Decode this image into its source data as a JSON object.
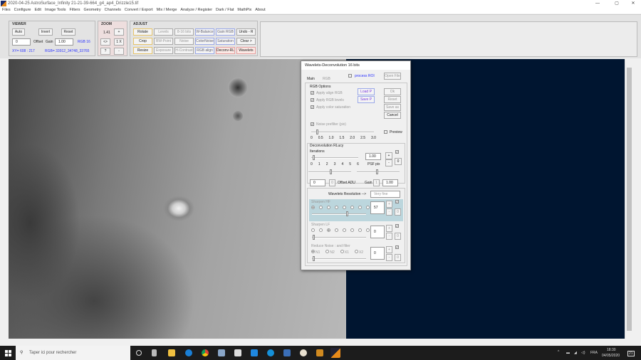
{
  "window": {
    "title": "2020-04-25  AstroSurface_Infinity   21-21-39-664_g4_ap4_Drizzle15.tif",
    "min": "—",
    "max": "▢",
    "close": "✕"
  },
  "menu": [
    "Files",
    "Configure",
    "Edit",
    "Image Tools",
    "Filters",
    "Geometry",
    "Channels",
    "Convert / Export",
    "Mix / Merge",
    "Analyze / Register",
    "Dark / Flat",
    "MathPix",
    "About"
  ],
  "viewer": {
    "label": "VIEWER",
    "auto": "Auto",
    "invert": "Invert",
    "reset": "Reset",
    "offset_value": "0",
    "offset_label": "Offset",
    "gain_label": "Gain",
    "gain_value": "1.00",
    "rgb_mode": "RGB 16",
    "xy": "XY= 608 : 217",
    "rgb": "RGB= 33912_34748_33765"
  },
  "zoom": {
    "label": "ZOOM",
    "level": "1.41",
    "plus": "+",
    "fit": "<>",
    "one": "1 X",
    "help": "?",
    "minus": "-"
  },
  "adjust": {
    "label": "ADJUST",
    "buttons": [
      "Rotate",
      "Levels",
      "8-16 bits",
      "W-Balance",
      "Gain RGB",
      "Undo - R",
      "Crop",
      "BW-Point",
      "Noise",
      "ColorNoise",
      "Saturation",
      "Clear >",
      "Resize",
      "Exposure",
      "H-Contrast",
      "RGB align",
      "Deconv-RL",
      "Wavelets"
    ]
  },
  "dialog": {
    "title": "Wavelets-Deconvolution 16 bits",
    "tab_main": "Main",
    "tab_rgb": "RGB",
    "process_roi": "process ROI",
    "open_file": "Open File",
    "rgb_options": "RGB Options",
    "apply_align": "Apply align RGB",
    "apply_levels": "Apply RGB levels",
    "apply_saturation": "Apply color saturation",
    "load_p": "Load P",
    "save_p": "Save P",
    "ok": "Ok",
    "reset": "Reset",
    "saveas": "Save as",
    "cancel": "Cancel",
    "preview": "Preview",
    "noise_prefilter": "Noise prefilter (pix)",
    "prefilter_ticks": [
      "0",
      "0.5",
      "1.0",
      "1.5",
      "2.0",
      "2.5",
      "3.0"
    ],
    "deconv": "Deconvolution RLucy",
    "iterations": "Iterations",
    "iter_ticks": [
      "0",
      "1",
      "2",
      "3",
      "4",
      "5",
      "6"
    ],
    "psf_value": "1.00",
    "psf_label": "PSF pix",
    "plus": "+",
    "minus": "-",
    "zero": "0",
    "offset_value": "0",
    "offset_btn": "0",
    "offset_label": "Offset ADU",
    "gain_label": "Gain",
    "gain_btn": "1",
    "gain_value": "1.00",
    "wav_res_label": "Wavelets Resolution  -->",
    "wav_res_value": "Very fine",
    "sharpen_hf": "Sharpen HF",
    "hf_value": "57",
    "sharpen_lf": "Sharpen LF",
    "lf_value": "0",
    "reduce_noise": "Reduce Noise : and filter",
    "rn_value": "0",
    "rn_options": [
      "N1",
      "N2",
      "X1",
      "X2"
    ]
  },
  "taskbar": {
    "search_placeholder": "Taper ici pour rechercher",
    "lang": "FRA",
    "time": "18:30",
    "date": "04/05/2020",
    "notifications": "21"
  }
}
